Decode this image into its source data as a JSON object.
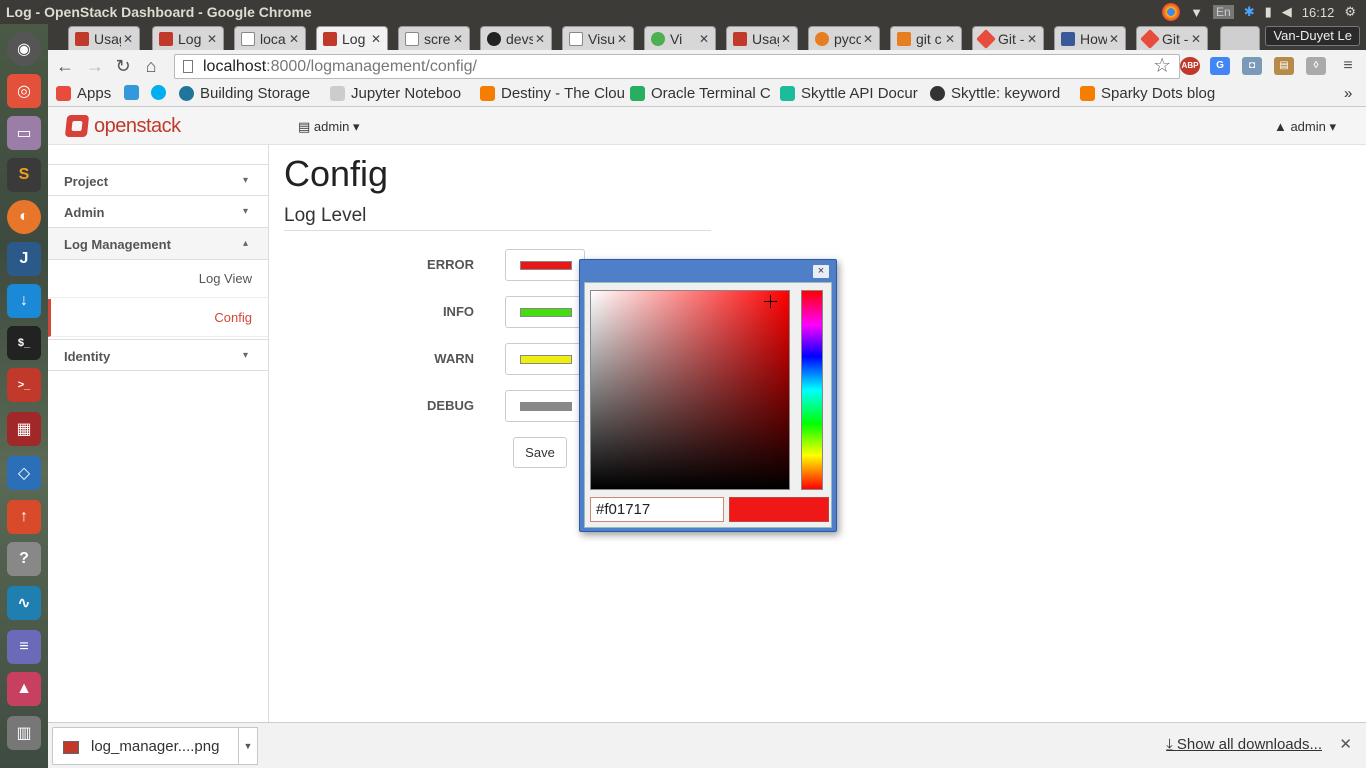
{
  "window": {
    "title": "Log - OpenStack Dashboard - Google Chrome"
  },
  "tray": {
    "input_method": "En",
    "clock": "16:12",
    "user": "Van-Duyet Le"
  },
  "tabs": [
    {
      "label": "Usag",
      "fav_color": "#c0392b"
    },
    {
      "label": "Log",
      "fav_color": "#c0392b"
    },
    {
      "label": "loca",
      "fav_color": "#ffffff"
    },
    {
      "label": "Log",
      "fav_color": "#c0392b"
    },
    {
      "label": "scre",
      "fav_color": "#ffffff"
    },
    {
      "label": "devs",
      "fav_color": "#222222"
    },
    {
      "label": "Visu",
      "fav_color": "#ffffff"
    },
    {
      "label": "Vi",
      "fav_color": "#4caf50"
    },
    {
      "label": "Usag",
      "fav_color": "#c0392b"
    },
    {
      "label": "pyco",
      "fav_color": "#e67e22"
    },
    {
      "label": "git c",
      "fav_color": "#e67e22"
    },
    {
      "label": "Git -",
      "fav_color": "#e74c3c"
    },
    {
      "label": "How",
      "fav_color": "#3b5998"
    },
    {
      "label": "Git -",
      "fav_color": "#e74c3c"
    }
  ],
  "address_bar": {
    "host": "localhost",
    "path": ":8000/logmanagement/config/"
  },
  "extensions": {
    "abp": "ABP"
  },
  "bookmarks": [
    {
      "label": "Apps",
      "color": "#e74c3c"
    },
    {
      "label": "",
      "color": "#3498db"
    },
    {
      "label": "",
      "color": "#00aff0"
    },
    {
      "label": "Building Storage",
      "color": "#21759b"
    },
    {
      "label": "Jupyter Noteboo",
      "color": "#888888"
    },
    {
      "label": "Destiny - The Clou",
      "color": "#f57d00"
    },
    {
      "label": "Oracle Terminal C",
      "color": "#27ae60"
    },
    {
      "label": "Skyttle API Docur",
      "color": "#1abc9c"
    },
    {
      "label": "Skyttle: keyword",
      "color": "#333333"
    },
    {
      "label": "Sparky Dots blog",
      "color": "#f57d00"
    }
  ],
  "openstack": {
    "brand": "openstack",
    "project_menu": "admin",
    "user_menu": "admin"
  },
  "sidebar": {
    "panels": [
      "Project",
      "Admin",
      "Log Management"
    ],
    "links": [
      "Log View",
      "Config"
    ],
    "identity": "Identity"
  },
  "content": {
    "title": "Config",
    "section": "Log Level",
    "levels": [
      {
        "label": "ERROR",
        "color": "#e81818"
      },
      {
        "label": "INFO",
        "color": "#44dd11"
      },
      {
        "label": "WARN",
        "color": "#eeee11"
      },
      {
        "label": "DEBUG",
        "color": "#888888"
      }
    ],
    "save_label": "Save"
  },
  "color_picker": {
    "hex_value": "#f01717",
    "preview_color": "#f01717",
    "close_label": "×"
  },
  "downloads": {
    "file_name": "log_manager....png",
    "show_all": "Show all downloads...",
    "close_label": "✕"
  }
}
